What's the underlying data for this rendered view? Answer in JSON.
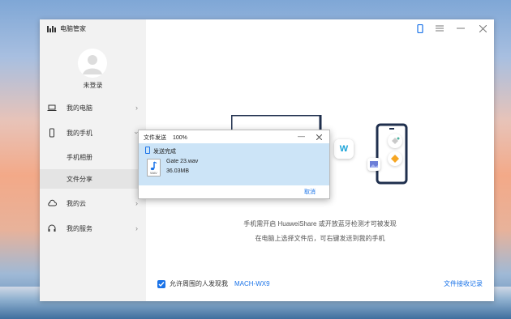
{
  "app": {
    "title": "电脑管家"
  },
  "user": {
    "login_label": "未登录"
  },
  "sidebar": {
    "items": [
      {
        "label": "我的电脑",
        "icon": "laptop-icon"
      },
      {
        "label": "我的手机",
        "icon": "phone-icon"
      },
      {
        "label": "手机相册"
      },
      {
        "label": "文件分享"
      },
      {
        "label": "我的云",
        "icon": "cloud-icon"
      },
      {
        "label": "我的服务",
        "icon": "headset-icon"
      }
    ]
  },
  "main": {
    "desc_line1": "手机需开启 HuaweiShare 或开放蓝牙检测才可被发现",
    "desc_line2": "在电脑上选择文件后，可右键发送到我的手机",
    "allow_label": "允许周围的人发现我",
    "device_name": "MACH-WX9",
    "history_link": "文件接收记录"
  },
  "dialog": {
    "title": "文件发送",
    "percent": "100%",
    "status": "发送完成",
    "file_name": "Gate 23.wav",
    "file_size": "36.03MB",
    "file_type": "WAV",
    "cancel": "取消"
  },
  "colors": {
    "accent": "#1a73e8",
    "selection": "#cce4f7"
  }
}
